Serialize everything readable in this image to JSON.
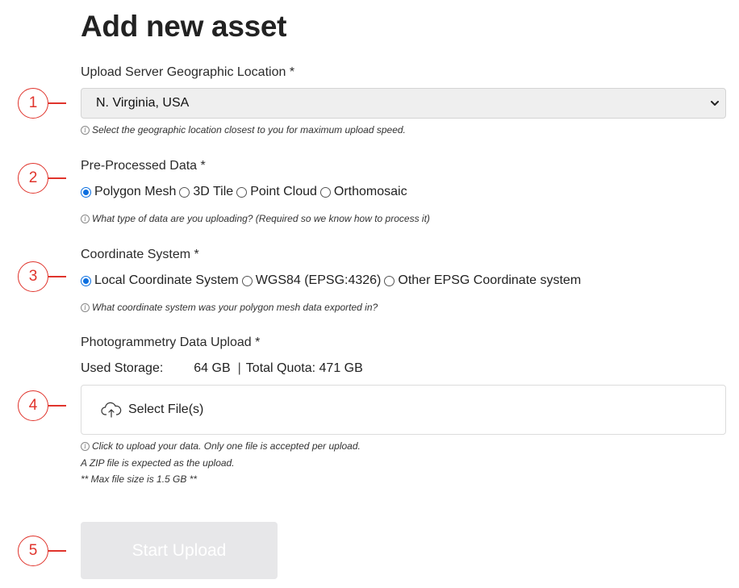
{
  "page": {
    "title": "Add new asset"
  },
  "location": {
    "label": "Upload Server Geographic Location *",
    "selected": "N. Virginia, USA",
    "hint": "Select the geographic location closest to you for maximum upload speed."
  },
  "data_type": {
    "label": "Pre-Processed Data *",
    "options": [
      "Polygon Mesh",
      "3D Tile",
      "Point Cloud",
      "Orthomosaic"
    ],
    "selected": "Polygon Mesh",
    "hint": "What type of data are you uploading? (Required so we know how to process it)"
  },
  "coordinate": {
    "label": "Coordinate System *",
    "options": [
      "Local Coordinate System",
      "WGS84 (EPSG:4326)",
      "Other EPSG Coordinate system"
    ],
    "selected": "Local Coordinate System",
    "hint": "What coordinate system was your polygon mesh data exported in?"
  },
  "upload": {
    "label": "Photogrammetry Data Upload *",
    "used_label": "Used Storage:",
    "used_value": "64 GB",
    "separator": "|",
    "quota_text": "Total Quota: 471 GB",
    "select_label": "Select File(s)",
    "hint_1": "Click to upload your data. Only one file is accepted per upload.",
    "hint_2": "A ZIP file is expected as the upload.",
    "hint_3": "** Max file size is 1.5 GB **"
  },
  "start_button": {
    "label": "Start Upload"
  },
  "steps": [
    "1",
    "2",
    "3",
    "4",
    "5"
  ],
  "colors": {
    "accent": "#0b6fe0",
    "step_marker": "#e0342c",
    "disabled_button": "#e7e7e9"
  },
  "icons": {
    "select": "chevron-down-icon",
    "info": "info-icon",
    "upload": "cloud-upload-icon"
  }
}
